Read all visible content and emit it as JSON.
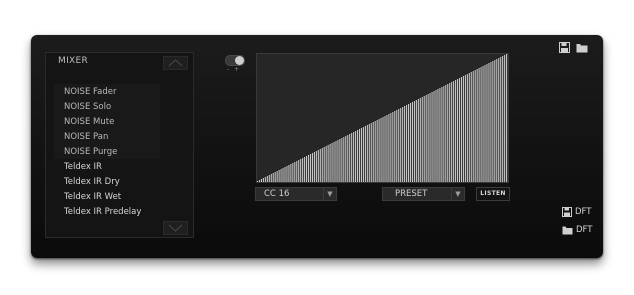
{
  "mixer": {
    "title": "MIXER",
    "items": [
      {
        "label": "NOISE Fader"
      },
      {
        "label": "NOISE Solo"
      },
      {
        "label": "NOISE Mute"
      },
      {
        "label": "NOISE Pan"
      },
      {
        "label": "NOISE Purge"
      },
      {
        "label": "Teldex IR"
      },
      {
        "label": "Teldex IR Dry"
      },
      {
        "label": "Teldex IR Wet"
      },
      {
        "label": "Teldex IR Predelay"
      }
    ]
  },
  "toggle": {
    "off_mark": "-",
    "on_mark": "+",
    "state": "on"
  },
  "controls": {
    "cc_value": "CC 16",
    "preset_value": "PRESET",
    "listen_label": "LISTEN"
  },
  "top_icons": [
    "save-icon",
    "folder-icon"
  ],
  "defaults": {
    "save_label": "DFT",
    "load_label": "DFT"
  },
  "colors": {
    "panel": "#141414",
    "curve_fill": "#e6e6e6",
    "text": "#cfcfcf"
  }
}
